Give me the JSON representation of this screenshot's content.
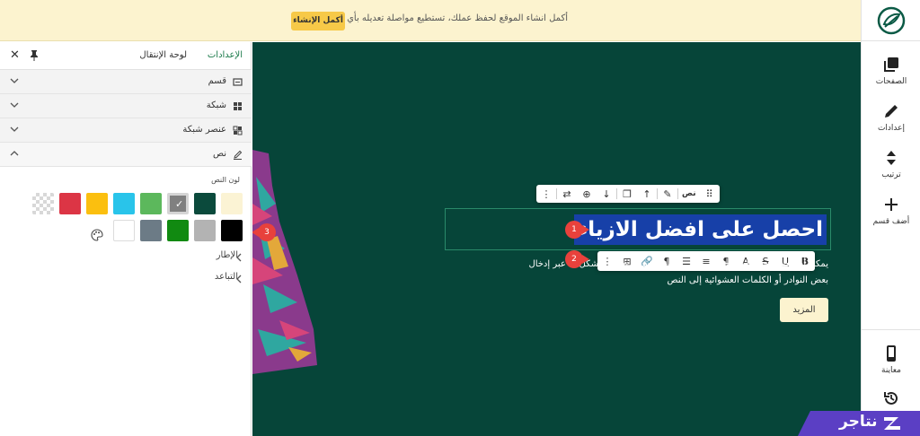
{
  "banner": {
    "message": "أكمل انشاء الموقع لحفظ عملك، تستطيع مواصلة تعديله بأي وقت",
    "button": "أكمل الإنشاء"
  },
  "rail": {
    "items": [
      {
        "label": "الصفحات",
        "icon": "pages-icon"
      },
      {
        "label": "إعدادات",
        "icon": "pencil-icon"
      },
      {
        "label": "ترتيب",
        "icon": "sort-icon"
      },
      {
        "label": "أضف قسم",
        "icon": "plus-icon"
      },
      {
        "label": "معاينة",
        "icon": "mobile-icon"
      },
      {
        "label": "",
        "icon": "history-icon"
      }
    ]
  },
  "panel": {
    "tabs": {
      "settings": "الإعدادات",
      "navigation": "لوحة الإنتقال"
    },
    "sections": [
      {
        "label": "قسم",
        "icon": "section-icon"
      },
      {
        "label": "شبكة",
        "icon": "grid-icon"
      },
      {
        "label": "عنصر شبكة",
        "icon": "grid-item-icon"
      },
      {
        "label": "نص",
        "icon": "text-edit-icon"
      }
    ],
    "color_title": "لون النص",
    "swatches_row1": [
      "#fbf3d4",
      "#0b4a3c",
      "#808080",
      "#5cb85c",
      "#29c4ea",
      "#fbbf0f",
      "#dc3545",
      "transparent"
    ],
    "swatches_row2": [
      "#000000",
      "#b3b3b3",
      "#118a11",
      "#6c7b86",
      "#ffffff"
    ],
    "sub_items": [
      "الإطار",
      "التباعد"
    ]
  },
  "canvas": {
    "heading": "احصل على افضل الازياء",
    "body_line1": "يمكن أن تحتوي هذه المساحة على نص تعريفي، سيتم تعديلها بشكل ما عبر إدخال",
    "body_line2": "بعض النوادر أو الكلمات العشوائية إلى النص",
    "more_button": "المزيد",
    "toolbar_label": "نص",
    "markers": [
      "1",
      "2",
      "3"
    ]
  },
  "brand": {
    "name": "نتاجر"
  },
  "colors": {
    "canvas": "#064539",
    "banner": "#fcf3cf",
    "accent": "#f7c948",
    "highlight": "#1740a8",
    "marker": "#e8413c",
    "brand": "#5b3fc4"
  }
}
